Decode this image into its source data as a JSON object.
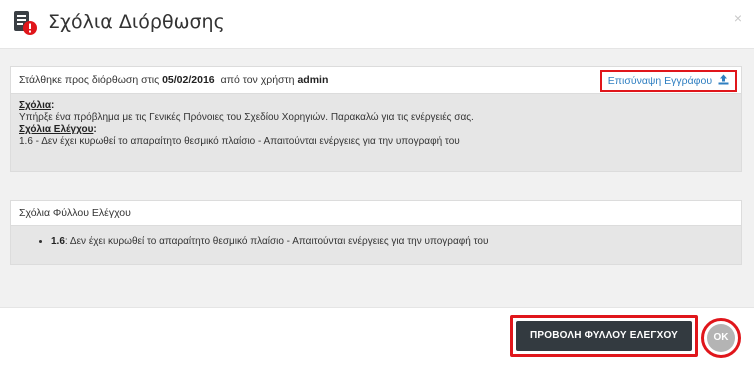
{
  "dialog": {
    "title": "Σχόλια Διόρθωσης",
    "close_label": "×"
  },
  "correction_panel": {
    "sent_prefix": "Στάλθηκε προς διόρθωση στις",
    "sent_date": "05/02/2016",
    "by_user_prefix": "από τον χρήστη",
    "user": "admin",
    "attach_label": "Επισύναψη Εγγράφου",
    "comments_label": "Σχόλια",
    "comments_text": "Υπήρξε ένα πρόβλημα με τις Γενικές Πρόνοιες του Σχεδίου Χορηγιών. Παρακαλώ για τις ενέργειές σας.",
    "check_comments_label": "Σχόλια Ελέγχου",
    "check_comments_text": "1.6 - Δεν έχει κυρωθεί το απαραίτητο θεσμικό πλαίσιο - Απαιτούνται ενέργειες για την υπογραφή του"
  },
  "checklist_panel": {
    "title": "Σχόλια Φύλλου Ελέγχου",
    "items": [
      {
        "code": "1.6",
        "text": ": Δεν έχει κυρωθεί το απαραίτητο θεσμικό πλαίσιο - Απαιτούνται ενέργειες για την υπογραφή του"
      }
    ]
  },
  "footer": {
    "view_checklist_label": "ΠΡΟΒΟΛΗ ΦΥΛΛΟΥ ΕΛΕΓΧΟΥ",
    "ok_label": "OK"
  },
  "colors": {
    "accent_red": "#e0161b",
    "link_blue": "#2f7fc1",
    "dark_button": "#333a40",
    "ok_button": "#b4b4b4"
  },
  "icons": {
    "dialog_icon": "document-alert-icon",
    "attach_icon": "upload-icon"
  }
}
